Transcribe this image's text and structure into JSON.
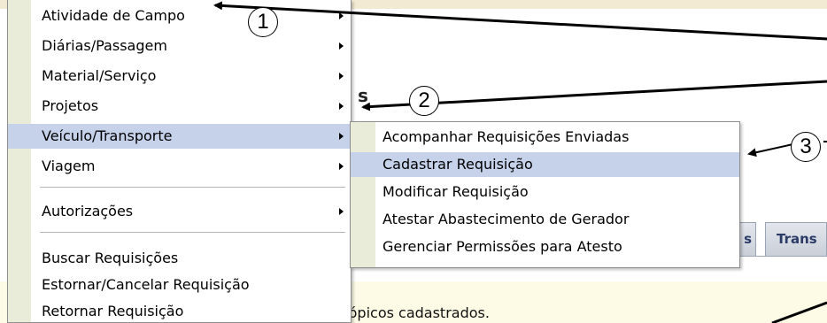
{
  "background": {
    "heading_fragment": "s",
    "tabs": [
      "s",
      "Trans"
    ],
    "notice_text": "nos tópicos cadastrados."
  },
  "main_menu": {
    "items": [
      {
        "label": "Atividade de Campo",
        "has_submenu": true
      },
      {
        "label": "Diárias/Passagem",
        "has_submenu": true
      },
      {
        "label": "Material/Serviço",
        "has_submenu": true
      },
      {
        "label": "Projetos",
        "has_submenu": true
      },
      {
        "label": "Veículo/Transporte",
        "has_submenu": true,
        "highlighted": true
      },
      {
        "label": "Viagem",
        "has_submenu": true
      },
      {
        "label": "Autorizações",
        "has_submenu": true
      },
      {
        "label": "Buscar Requisições",
        "has_submenu": false
      },
      {
        "label": "Estornar/Cancelar Requisição",
        "has_submenu": false
      },
      {
        "label": "Retornar Requisição",
        "has_submenu": false
      }
    ]
  },
  "submenu": {
    "items": [
      {
        "label": "Acompanhar Requisições Enviadas"
      },
      {
        "label": "Cadastrar Requisição",
        "highlighted": true
      },
      {
        "label": "Modificar Requisição"
      },
      {
        "label": "Atestar Abastecimento de Gerador"
      },
      {
        "label": "Gerenciar Permissões para Atesto"
      }
    ]
  },
  "annotations": {
    "badges": [
      "1",
      "2",
      "3"
    ]
  },
  "colors": {
    "highlight": "#c6d1ea",
    "gutter": "#e9ecd9",
    "notice_bg": "#fdfbe6",
    "topbar": "#f2ead3"
  }
}
